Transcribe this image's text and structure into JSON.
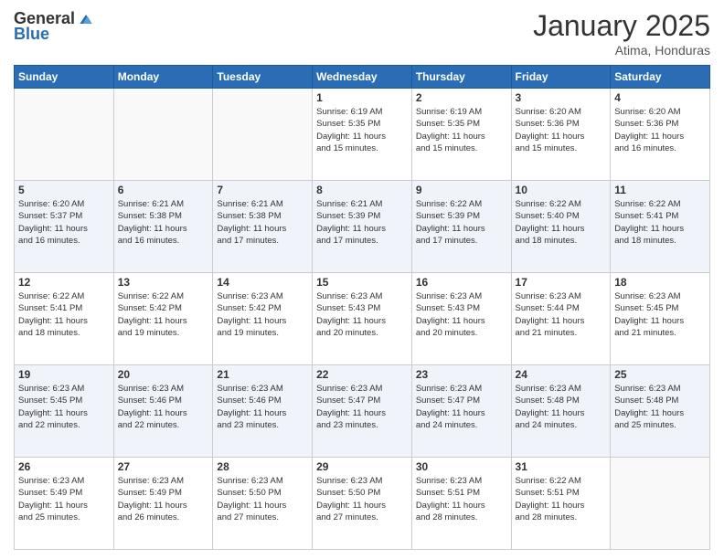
{
  "logo": {
    "general": "General",
    "blue": "Blue"
  },
  "header": {
    "month": "January 2025",
    "location": "Atima, Honduras"
  },
  "weekdays": [
    "Sunday",
    "Monday",
    "Tuesday",
    "Wednesday",
    "Thursday",
    "Friday",
    "Saturday"
  ],
  "weeks": [
    [
      {
        "day": null,
        "info": null
      },
      {
        "day": null,
        "info": null
      },
      {
        "day": null,
        "info": null
      },
      {
        "day": "1",
        "info": "Sunrise: 6:19 AM\nSunset: 5:35 PM\nDaylight: 11 hours\nand 15 minutes."
      },
      {
        "day": "2",
        "info": "Sunrise: 6:19 AM\nSunset: 5:35 PM\nDaylight: 11 hours\nand 15 minutes."
      },
      {
        "day": "3",
        "info": "Sunrise: 6:20 AM\nSunset: 5:36 PM\nDaylight: 11 hours\nand 15 minutes."
      },
      {
        "day": "4",
        "info": "Sunrise: 6:20 AM\nSunset: 5:36 PM\nDaylight: 11 hours\nand 16 minutes."
      }
    ],
    [
      {
        "day": "5",
        "info": "Sunrise: 6:20 AM\nSunset: 5:37 PM\nDaylight: 11 hours\nand 16 minutes."
      },
      {
        "day": "6",
        "info": "Sunrise: 6:21 AM\nSunset: 5:38 PM\nDaylight: 11 hours\nand 16 minutes."
      },
      {
        "day": "7",
        "info": "Sunrise: 6:21 AM\nSunset: 5:38 PM\nDaylight: 11 hours\nand 17 minutes."
      },
      {
        "day": "8",
        "info": "Sunrise: 6:21 AM\nSunset: 5:39 PM\nDaylight: 11 hours\nand 17 minutes."
      },
      {
        "day": "9",
        "info": "Sunrise: 6:22 AM\nSunset: 5:39 PM\nDaylight: 11 hours\nand 17 minutes."
      },
      {
        "day": "10",
        "info": "Sunrise: 6:22 AM\nSunset: 5:40 PM\nDaylight: 11 hours\nand 18 minutes."
      },
      {
        "day": "11",
        "info": "Sunrise: 6:22 AM\nSunset: 5:41 PM\nDaylight: 11 hours\nand 18 minutes."
      }
    ],
    [
      {
        "day": "12",
        "info": "Sunrise: 6:22 AM\nSunset: 5:41 PM\nDaylight: 11 hours\nand 18 minutes."
      },
      {
        "day": "13",
        "info": "Sunrise: 6:22 AM\nSunset: 5:42 PM\nDaylight: 11 hours\nand 19 minutes."
      },
      {
        "day": "14",
        "info": "Sunrise: 6:23 AM\nSunset: 5:42 PM\nDaylight: 11 hours\nand 19 minutes."
      },
      {
        "day": "15",
        "info": "Sunrise: 6:23 AM\nSunset: 5:43 PM\nDaylight: 11 hours\nand 20 minutes."
      },
      {
        "day": "16",
        "info": "Sunrise: 6:23 AM\nSunset: 5:43 PM\nDaylight: 11 hours\nand 20 minutes."
      },
      {
        "day": "17",
        "info": "Sunrise: 6:23 AM\nSunset: 5:44 PM\nDaylight: 11 hours\nand 21 minutes."
      },
      {
        "day": "18",
        "info": "Sunrise: 6:23 AM\nSunset: 5:45 PM\nDaylight: 11 hours\nand 21 minutes."
      }
    ],
    [
      {
        "day": "19",
        "info": "Sunrise: 6:23 AM\nSunset: 5:45 PM\nDaylight: 11 hours\nand 22 minutes."
      },
      {
        "day": "20",
        "info": "Sunrise: 6:23 AM\nSunset: 5:46 PM\nDaylight: 11 hours\nand 22 minutes."
      },
      {
        "day": "21",
        "info": "Sunrise: 6:23 AM\nSunset: 5:46 PM\nDaylight: 11 hours\nand 23 minutes."
      },
      {
        "day": "22",
        "info": "Sunrise: 6:23 AM\nSunset: 5:47 PM\nDaylight: 11 hours\nand 23 minutes."
      },
      {
        "day": "23",
        "info": "Sunrise: 6:23 AM\nSunset: 5:47 PM\nDaylight: 11 hours\nand 24 minutes."
      },
      {
        "day": "24",
        "info": "Sunrise: 6:23 AM\nSunset: 5:48 PM\nDaylight: 11 hours\nand 24 minutes."
      },
      {
        "day": "25",
        "info": "Sunrise: 6:23 AM\nSunset: 5:48 PM\nDaylight: 11 hours\nand 25 minutes."
      }
    ],
    [
      {
        "day": "26",
        "info": "Sunrise: 6:23 AM\nSunset: 5:49 PM\nDaylight: 11 hours\nand 25 minutes."
      },
      {
        "day": "27",
        "info": "Sunrise: 6:23 AM\nSunset: 5:49 PM\nDaylight: 11 hours\nand 26 minutes."
      },
      {
        "day": "28",
        "info": "Sunrise: 6:23 AM\nSunset: 5:50 PM\nDaylight: 11 hours\nand 27 minutes."
      },
      {
        "day": "29",
        "info": "Sunrise: 6:23 AM\nSunset: 5:50 PM\nDaylight: 11 hours\nand 27 minutes."
      },
      {
        "day": "30",
        "info": "Sunrise: 6:23 AM\nSunset: 5:51 PM\nDaylight: 11 hours\nand 28 minutes."
      },
      {
        "day": "31",
        "info": "Sunrise: 6:22 AM\nSunset: 5:51 PM\nDaylight: 11 hours\nand 28 minutes."
      },
      {
        "day": null,
        "info": null
      }
    ]
  ]
}
